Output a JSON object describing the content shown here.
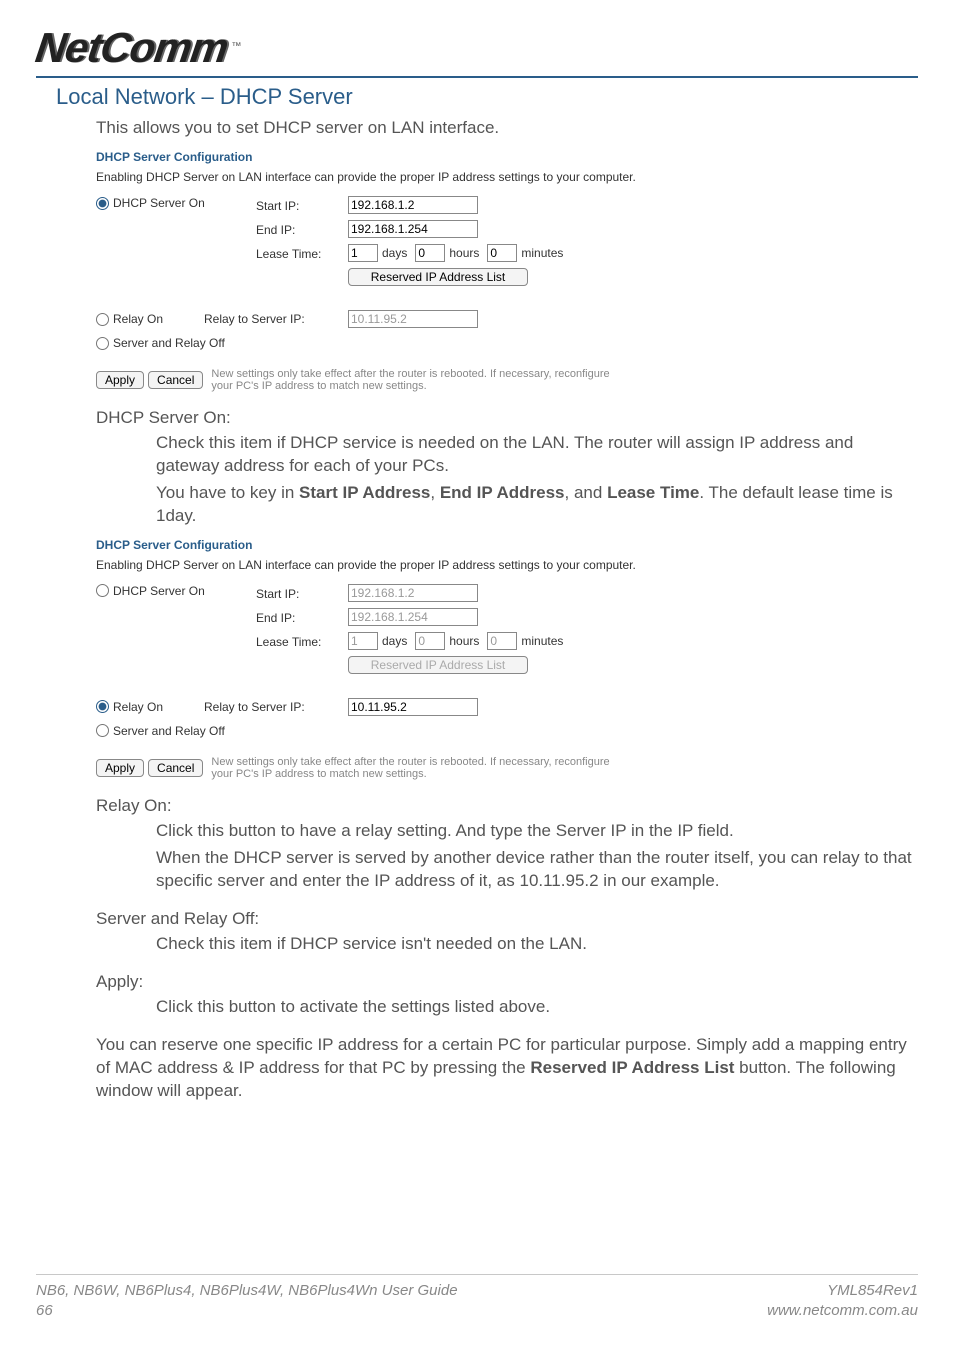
{
  "logo": {
    "text": "NetComm",
    "tm": "™"
  },
  "section_title": "Local Network – DHCP Server",
  "intro": "This allows you to set DHCP server on LAN interface.",
  "panel1": {
    "title": "DHCP Server Configuration",
    "desc": "Enabling DHCP Server on LAN interface can provide the proper IP address settings to your computer.",
    "dhcp_on": {
      "label": "DHCP Server On",
      "checked": true
    },
    "start_ip": {
      "label": "Start IP:",
      "value": "192.168.1.2"
    },
    "end_ip": {
      "label": "End IP:",
      "value": "192.168.1.254"
    },
    "lease": {
      "label": "Lease Time:",
      "days_value": "1",
      "days_label": "days",
      "hours_value": "0",
      "hours_label": "hours",
      "minutes_value": "0",
      "minutes_label": "minutes"
    },
    "reserved_btn": "Reserved IP Address List",
    "relay_on": {
      "label": "Relay On",
      "checked": false
    },
    "relay_server": {
      "label": "Relay to Server IP:",
      "value": "10.11.95.2"
    },
    "off": {
      "label": "Server and Relay Off",
      "checked": false
    },
    "apply": "Apply",
    "cancel": "Cancel",
    "note": "New settings only take effect after the router is rebooted. If necessary, reconfigure your PC's IP address to match new settings."
  },
  "doc_dhcp_on": {
    "heading": "DHCP Server On:",
    "p1": "Check this item if DHCP service is needed on the LAN. The router will assign IP address and gateway address for each of your PCs.",
    "p2_pre": "You have to key in ",
    "p2_b1": "Start IP Address",
    "p2_sep1": ", ",
    "p2_b2": "End IP Address",
    "p2_sep2": ", and ",
    "p2_b3": "Lease Time",
    "p2_post": ". The default lease time is 1day."
  },
  "panel2": {
    "title": "DHCP Server Configuration",
    "desc": "Enabling DHCP Server on LAN interface can provide the proper IP address settings to your computer.",
    "dhcp_on": {
      "label": "DHCP Server On",
      "checked": false
    },
    "start_ip": {
      "label": "Start IP:",
      "value": "192.168.1.2"
    },
    "end_ip": {
      "label": "End IP:",
      "value": "192.168.1.254"
    },
    "lease": {
      "label": "Lease Time:",
      "days_value": "1",
      "days_label": "days",
      "hours_value": "0",
      "hours_label": "hours",
      "minutes_value": "0",
      "minutes_label": "minutes"
    },
    "reserved_btn": "Reserved IP Address List",
    "relay_on": {
      "label": "Relay On",
      "checked": true
    },
    "relay_server": {
      "label": "Relay to Server IP:",
      "value": "10.11.95.2"
    },
    "off": {
      "label": "Server and Relay Off",
      "checked": false
    },
    "apply": "Apply",
    "cancel": "Cancel",
    "note": "New settings only take effect after the router is rebooted. If necessary, reconfigure your PC's IP address to match new settings."
  },
  "doc_relay": {
    "heading": "Relay On:",
    "p1": "Click this button to have a relay setting. And type the Server IP in the IP field.",
    "p2": "When the DHCP server is served by another device rather than the router itself, you can relay to that specific server and enter the IP address of it, as 10.11.95.2 in our example."
  },
  "doc_off": {
    "heading": "Server and Relay Off:",
    "p1": "Check this item if DHCP service isn't needed on the LAN."
  },
  "doc_apply": {
    "heading": "Apply:",
    "p1": "Click this button to activate the settings listed above."
  },
  "doc_reserve": {
    "pre": "You can reserve one specific IP address for a certain PC for particular purpose. Simply add a mapping entry of MAC address & IP address for that PC by pressing the ",
    "b": "Reserved IP Address List",
    "post": " button. The following window will appear."
  },
  "footer": {
    "guide": "NB6, NB6W, NB6Plus4, NB6Plus4W, NB6Plus4Wn User Guide",
    "page": "66",
    "rev": "YML854Rev1",
    "url": "www.netcomm.com.au"
  }
}
